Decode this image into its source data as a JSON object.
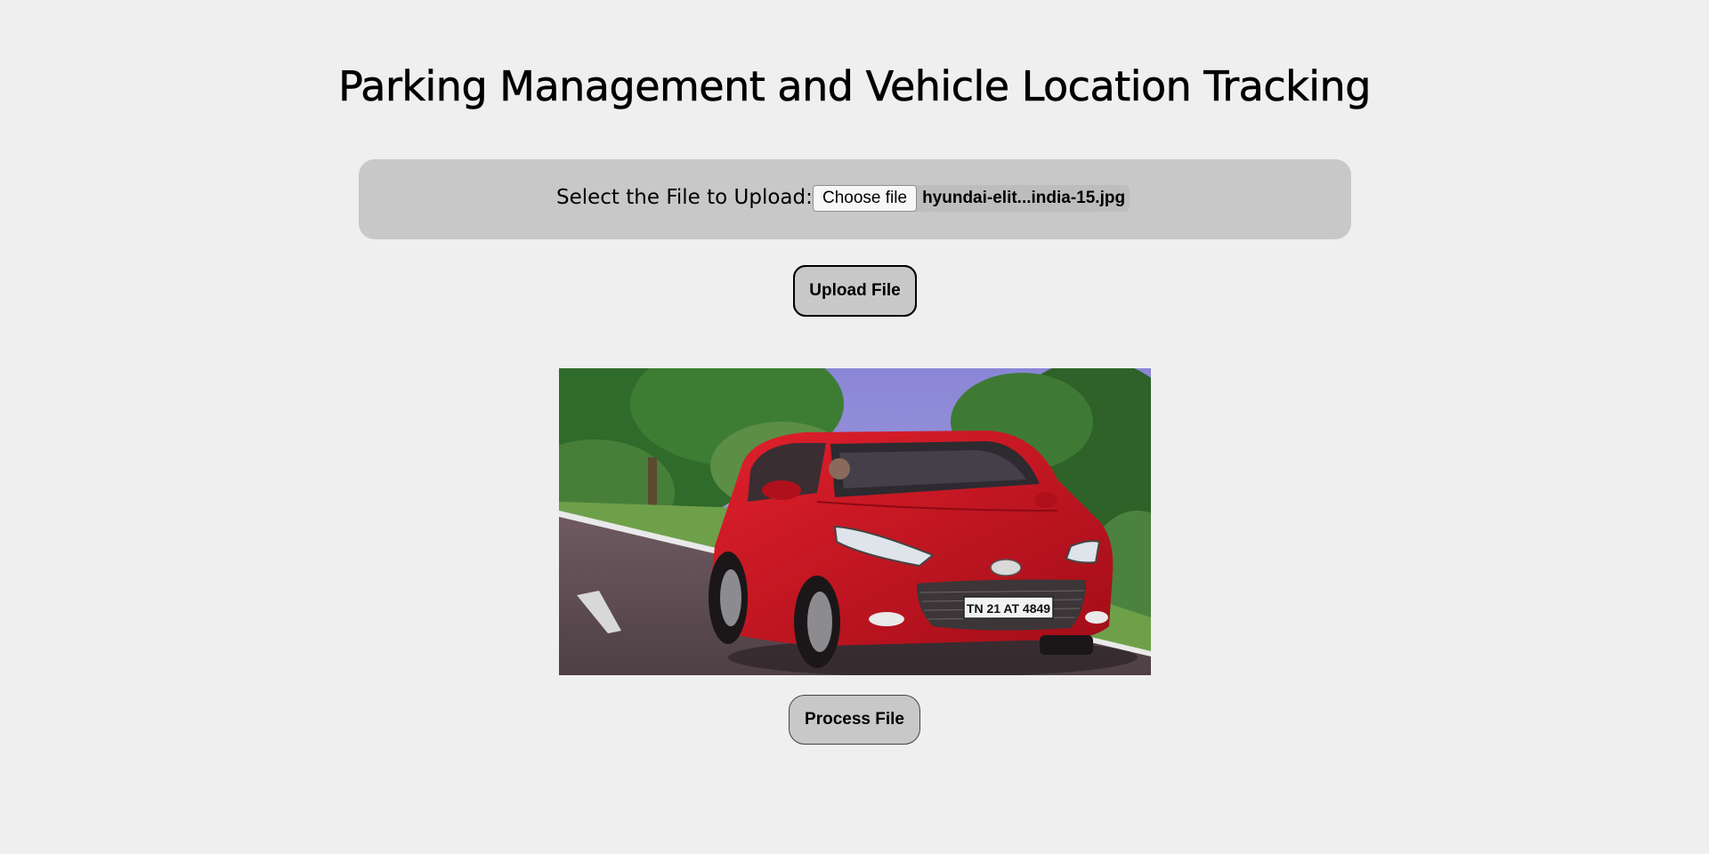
{
  "page": {
    "title": "Parking Management and Vehicle Location Tracking"
  },
  "upload": {
    "label": "Select the File to Upload:",
    "choose_button": "Choose file",
    "file_name": "hyundai-elit...india-15.jpg",
    "upload_button": "Upload File"
  },
  "preview": {
    "image_name": "uploaded-car-photo",
    "plate_text": "TN 21 AT 4849"
  },
  "actions": {
    "process_button": "Process File"
  },
  "colors": {
    "background": "#efefef",
    "panel": "#c8c8c8",
    "button": "#c8c8c8",
    "car": "#c8141e"
  }
}
